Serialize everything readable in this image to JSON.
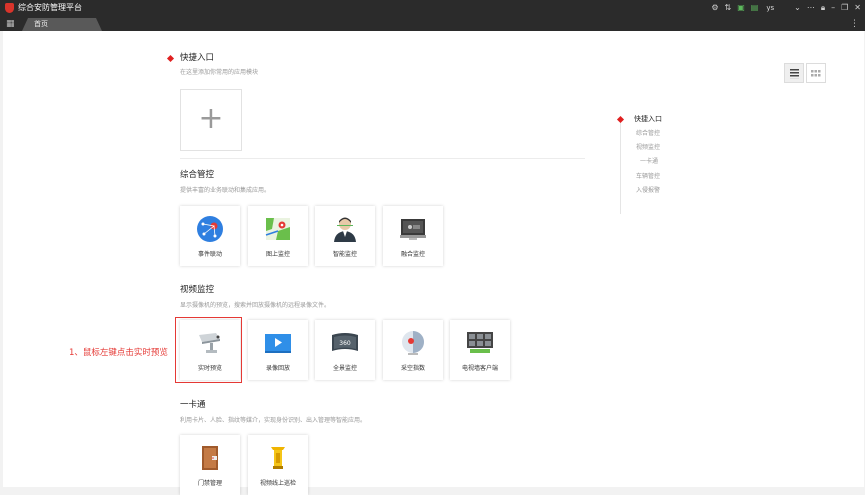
{
  "window": {
    "title": "综合安防管理平台",
    "user": "ys"
  },
  "tabs": [
    {
      "label": "首页"
    }
  ],
  "quick_entry": {
    "title": "快捷入口",
    "desc": "在这里添加你常用的应用模块",
    "add_symbol": "+"
  },
  "sections": {
    "integrated": {
      "title": "综合管控",
      "desc": "提供丰富的业务联动和集成应用。",
      "items": [
        {
          "label": "事件联动"
        },
        {
          "label": "图上监控"
        },
        {
          "label": "智能监控"
        },
        {
          "label": "融合监控"
        }
      ]
    },
    "video": {
      "title": "视频监控",
      "desc": "显示摄像机的预览，搜索并回放摄像机的远程录像文件。",
      "items": [
        {
          "label": "实时预览"
        },
        {
          "label": "录像回放"
        },
        {
          "label": "全景监控"
        },
        {
          "label": "采空指数"
        },
        {
          "label": "电视墙客户端"
        }
      ]
    },
    "card": {
      "title": "一卡通",
      "desc": "利用卡片、人脸、指纹等媒介，实现身份识别、出入管理等智能应用。",
      "items": [
        {
          "label": "门禁管理"
        },
        {
          "label": "视频线上巡检"
        }
      ]
    }
  },
  "annotation": "1、鼠标左键点击实时预览",
  "anchor_nav": [
    "快捷入口",
    "综合管控",
    "视频监控",
    "一卡通",
    "车辆管控",
    "入侵报警"
  ],
  "colors": {
    "accent": "#e02020",
    "highlight": "#e53935",
    "titlebar": "#2b2b2b"
  },
  "icons": {
    "titlebar": [
      "gear-icon",
      "sort-icon",
      "monitor-icon",
      "device-icon",
      "chevron-down-icon",
      "more-icon",
      "lock-icon",
      "minimize-icon",
      "restore-icon",
      "close-icon"
    ]
  }
}
